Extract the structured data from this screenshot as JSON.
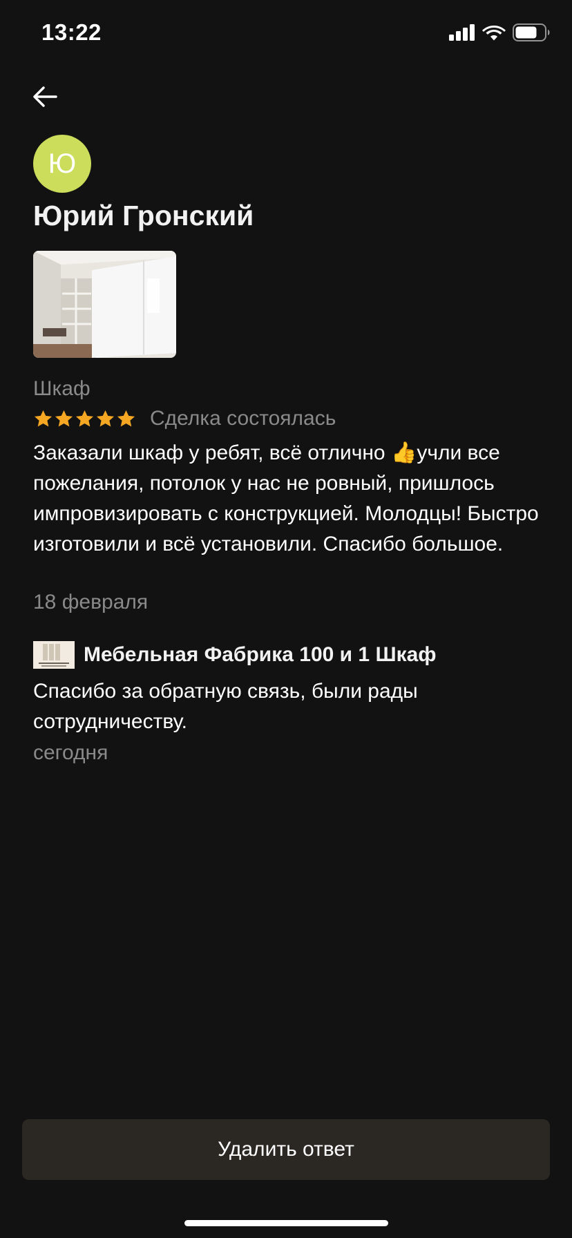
{
  "status_bar": {
    "time": "13:22",
    "signal_icon": "cellular-signal-icon",
    "wifi_icon": "wifi-icon",
    "battery_icon": "battery-icon"
  },
  "nav": {
    "back_icon": "arrow-left-icon"
  },
  "review": {
    "avatar_letter": "Ю",
    "avatar_color": "#ccdc5b",
    "reviewer_name": "Юрий Гронский",
    "product_title": "Шкаф",
    "rating": 5,
    "rating_max": 5,
    "star_color": "#f5a623",
    "deal_status": "Сделка состоялась",
    "text_before_emoji": "Заказали шкаф у ребят, всё отлично ",
    "emoji": "👍",
    "text_after_emoji": "учли все пожелания, потолок у нас не ровный, пришлось импровизировать с конструкцией. Молодцы! Быстро изготовили и всё установили. Спасибо большое.",
    "date": "18 февраля"
  },
  "reply": {
    "author": "Мебельная Фабрика 100 и 1 Шкаф",
    "text": "Спасибо за обратную связь, были рады сотрудничеству.",
    "date": "сегодня"
  },
  "actions": {
    "delete_reply_label": "Удалить ответ"
  }
}
